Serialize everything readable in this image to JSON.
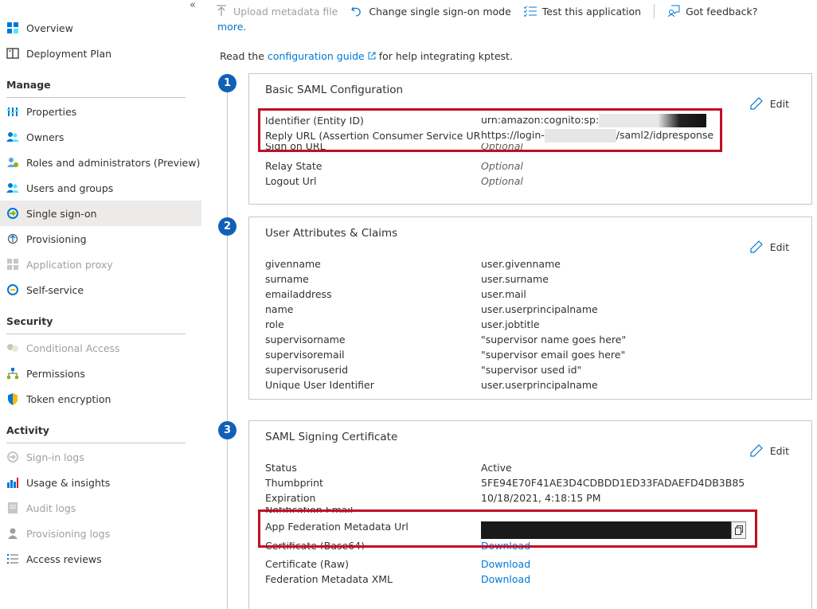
{
  "sidebar": {
    "collapse_glyph": "«",
    "top_items": [
      {
        "label": "Overview",
        "icon": "grid-icon"
      },
      {
        "label": "Deployment Plan",
        "icon": "book-icon"
      }
    ],
    "sections": [
      {
        "title": "Manage",
        "items": [
          {
            "label": "Properties",
            "icon": "properties-icon"
          },
          {
            "label": "Owners",
            "icon": "owners-icon"
          },
          {
            "label": "Roles and administrators (Preview)",
            "icon": "roles-icon"
          },
          {
            "label": "Users and groups",
            "icon": "users-icon"
          },
          {
            "label": "Single sign-on",
            "icon": "sso-icon",
            "active": true
          },
          {
            "label": "Provisioning",
            "icon": "provisioning-icon"
          },
          {
            "label": "Application proxy",
            "icon": "app-proxy-icon",
            "disabled": true
          },
          {
            "label": "Self-service",
            "icon": "self-service-icon"
          }
        ]
      },
      {
        "title": "Security",
        "items": [
          {
            "label": "Conditional Access",
            "icon": "conditional-access-icon",
            "disabled": true
          },
          {
            "label": "Permissions",
            "icon": "permissions-icon"
          },
          {
            "label": "Token encryption",
            "icon": "shield-icon"
          }
        ]
      },
      {
        "title": "Activity",
        "items": [
          {
            "label": "Sign-in logs",
            "icon": "sign-in-logs-icon",
            "disabled": true
          },
          {
            "label": "Usage & insights",
            "icon": "chart-icon"
          },
          {
            "label": "Audit logs",
            "icon": "audit-logs-icon",
            "disabled": true
          },
          {
            "label": "Provisioning logs",
            "icon": "person-icon",
            "disabled": true
          },
          {
            "label": "Access reviews",
            "icon": "list-icon"
          }
        ]
      }
    ]
  },
  "toolbar": {
    "upload_label": "Upload metadata file",
    "change_label": "Change single sign-on mode",
    "test_label": "Test this application",
    "feedback_label": "Got feedback?"
  },
  "more_link": "more.",
  "intro": {
    "prefix": "Read the ",
    "link": "configuration guide",
    "suffix": " for help integrating kptest."
  },
  "edit_label": "Edit",
  "cards": {
    "saml": {
      "step": "1",
      "title": "Basic SAML Configuration",
      "rows": [
        {
          "key": "Identifier (Entity ID)",
          "value": "urn:amazon:cognito:sp:"
        },
        {
          "key": "Reply URL (Assertion Consumer Service URL)",
          "value_prefix": "https://login-",
          "value_suffix": "/saml2/idpresponse"
        },
        {
          "key": "Sign on URL",
          "value": "Optional"
        },
        {
          "key": "Relay State",
          "value": "Optional"
        },
        {
          "key": "Logout Url",
          "value": "Optional"
        }
      ]
    },
    "claims": {
      "step": "2",
      "title": "User Attributes & Claims",
      "rows": [
        {
          "key": "givenname",
          "value": "user.givenname"
        },
        {
          "key": "surname",
          "value": "user.surname"
        },
        {
          "key": "emailaddress",
          "value": "user.mail"
        },
        {
          "key": "name",
          "value": "user.userprincipalname"
        },
        {
          "key": "role",
          "value": "user.jobtitle"
        },
        {
          "key": "supervisorname",
          "value": "\"supervisor name goes here\""
        },
        {
          "key": "supervisoremail",
          "value": "\"supervisor email goes here\""
        },
        {
          "key": "supervisoruserid",
          "value": "\"supervisor used id\""
        },
        {
          "key": "Unique User Identifier",
          "value": "user.userprincipalname"
        }
      ]
    },
    "cert": {
      "step": "3",
      "title": "SAML Signing Certificate",
      "rows": [
        {
          "key": "Status",
          "value": "Active"
        },
        {
          "key": "Thumbprint",
          "value": "5FE94E70F41AE3D4CDBDD1ED33FADAEFD4DB3B85"
        },
        {
          "key": "Expiration",
          "value": "10/18/2021, 4:18:15 PM"
        },
        {
          "key": "Notification Email",
          "value": ""
        },
        {
          "key": "App Federation Metadata Url",
          "value": ""
        },
        {
          "key": "Certificate (Base64)",
          "value": "Download"
        },
        {
          "key": "Certificate (Raw)",
          "value": "Download"
        },
        {
          "key": "Federation Metadata XML",
          "value": "Download"
        }
      ]
    }
  },
  "colors": {
    "accent": "#0078d4",
    "step_circle": "#1160b7",
    "highlight": "#c30d26"
  }
}
